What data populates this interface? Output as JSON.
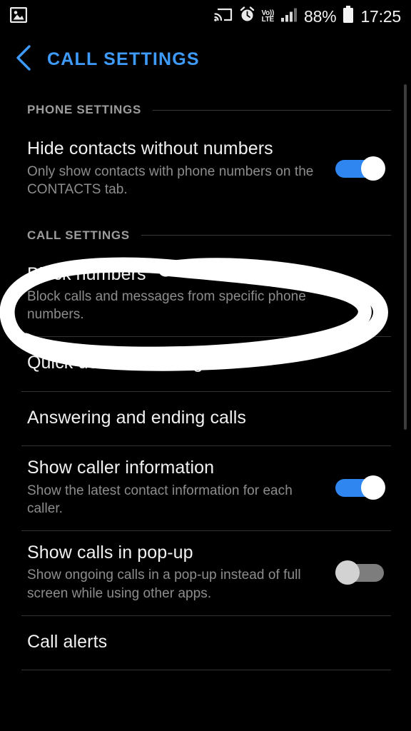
{
  "status_bar": {
    "left_icons": [
      {
        "name": "image-notification-icon",
        "glyph": "image"
      }
    ],
    "right_icons": [
      {
        "name": "cast-icon",
        "glyph": "cast"
      },
      {
        "name": "alarm-icon",
        "glyph": "alarm"
      },
      {
        "name": "volte-icon",
        "line1": "Vo))",
        "line2": "LTE"
      },
      {
        "name": "signal-icon",
        "glyph": "signal"
      }
    ],
    "battery_percent": "88%",
    "time": "17:25"
  },
  "app_bar": {
    "back_label": "Back",
    "title": "CALL SETTINGS",
    "title_color": "#3e9bfb"
  },
  "sections": [
    {
      "header": "PHONE SETTINGS",
      "rows": [
        {
          "title": "Hide contacts without numbers",
          "subtitle": "Only show contacts with phone numbers on the CONTACTS tab.",
          "control": "toggle",
          "toggle_state": "on",
          "divider_after": false
        }
      ]
    },
    {
      "header": "CALL SETTINGS",
      "rows": [
        {
          "title": "Block numbers",
          "subtitle": "Block calls and messages from specific phone numbers.",
          "control": "none",
          "toggle_state": "",
          "divider_after": true
        },
        {
          "title": "Quick decline messages",
          "subtitle": "",
          "control": "none",
          "toggle_state": "",
          "divider_after": true
        },
        {
          "title": "Answering and ending calls",
          "subtitle": "",
          "control": "none",
          "toggle_state": "",
          "divider_after": true
        },
        {
          "title": "Show caller information",
          "subtitle": "Show the latest contact information for each caller.",
          "control": "toggle",
          "toggle_state": "on",
          "divider_after": true
        },
        {
          "title": "Show calls in pop-up",
          "subtitle": "Show ongoing calls in a pop-up instead of full screen while using other apps.",
          "control": "toggle",
          "toggle_state": "off",
          "divider_after": true
        },
        {
          "title": "Call alerts",
          "subtitle": "",
          "control": "none",
          "toggle_state": "",
          "divider_after": true
        }
      ]
    }
  ],
  "annotation": {
    "type": "hand-drawn-ellipse",
    "color": "#ffffff",
    "target": "Block numbers"
  },
  "colors": {
    "background": "#000000",
    "title_text": "#f1f1f1",
    "subtitle_text": "#8d8d8d",
    "section_header_text": "#9c9c9c",
    "accent_blue": "#3e9bfb",
    "toggle_on": "#2f86f0",
    "toggle_off": "#7d7d7d",
    "divider": "#333333"
  }
}
